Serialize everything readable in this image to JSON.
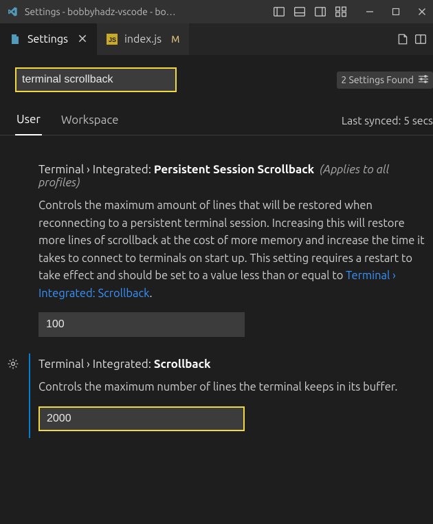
{
  "window": {
    "title": "Settings - bobbyhadz-vscode - bo…"
  },
  "tabs": {
    "settings_label": "Settings",
    "indexjs_label": "index.js",
    "indexjs_modified_marker": "M"
  },
  "search": {
    "query": "terminal scrollback",
    "results_label": "2 Settings Found"
  },
  "scopes": {
    "user": "User",
    "workspace": "Workspace",
    "last_synced": "Last synced: 5 secs"
  },
  "settings": {
    "persistent": {
      "crumb": "Terminal › Integrated:",
      "name": "Persistent Session Scrollback",
      "note": "(Applies to all profiles)",
      "desc_pre": "Controls the maximum amount of lines that will be restored when reconnecting to a persistent terminal session. Increasing this will restore more lines of scrollback at the cost of more memory and increase the time it takes to connect to terminals on start up. This setting requires a restart to take effect and should be set to a value less than or equal to ",
      "desc_link": "Terminal › Integrated: Scrollback",
      "desc_post": ".",
      "value": "100"
    },
    "scrollback": {
      "crumb": "Terminal › Integrated:",
      "name": "Scrollback",
      "desc": "Controls the maximum number of lines the terminal keeps in its buffer.",
      "value": "2000"
    }
  }
}
